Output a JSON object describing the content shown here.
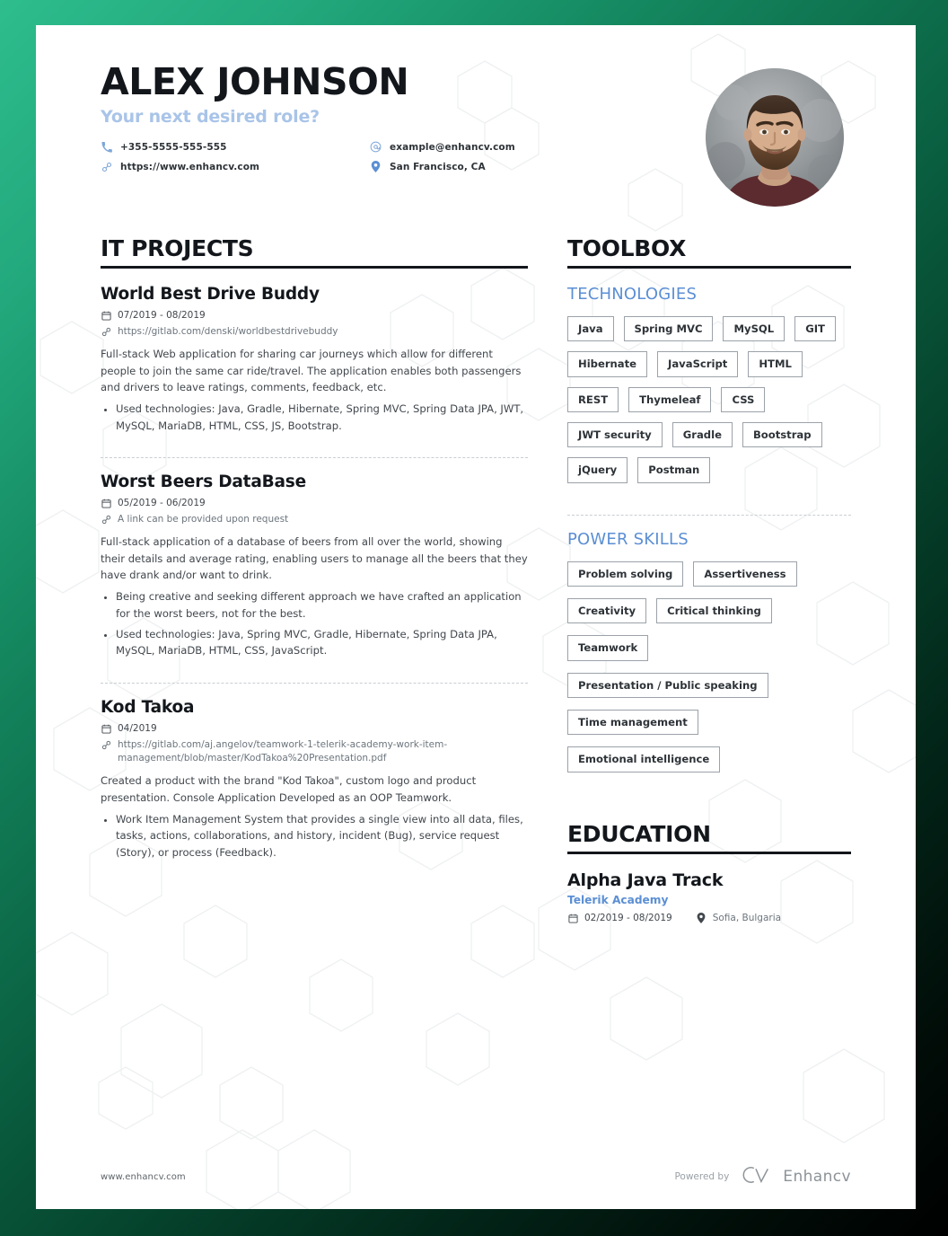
{
  "header": {
    "name": "ALEX JOHNSON",
    "tagline": "Your next desired role?",
    "contacts": [
      {
        "icon": "phone-icon",
        "text": "+355-5555-555-555"
      },
      {
        "icon": "email-icon",
        "text": "example@enhancv.com"
      },
      {
        "icon": "link-icon",
        "text": "https://www.enhancv.com"
      },
      {
        "icon": "location-icon",
        "text": "San Francisco, CA"
      }
    ],
    "avatar_alt": "profile-photo"
  },
  "projects": {
    "section_title": "IT PROJECTS",
    "entries": [
      {
        "title": "World Best Drive Buddy",
        "date": "07/2019 - 08/2019",
        "link": "https://gitlab.com/denski/worldbestdrivebuddy",
        "description": "Full-stack Web application for sharing car journeys which allow for different people to join the same car ride/travel. The application enables both passengers and drivers to leave ratings, comments, feedback, etc.",
        "bullets": [
          "Used technologies: Java, Gradle, Hibernate, Spring MVC, Spring Data JPA, JWT, MySQL, MariaDB, HTML, CSS, JS, Bootstrap."
        ]
      },
      {
        "title": "Worst Beers DataBase",
        "date": "05/2019 - 06/2019",
        "link": "A link can be provided upon request",
        "description": "Full-stack application of a database of beers from all over the world, showing their details and average rating, enabling users to manage all the beers that they have drank and/or want to drink.",
        "bullets": [
          "Being creative and seeking different approach we have crafted an application for the worst beers, not for the best.",
          "Used technologies: Java, Spring MVC, Gradle, Hibernate, Spring Data JPA, MySQL, MariaDB, HTML, CSS, JavaScript."
        ]
      },
      {
        "title": "Kod Takoa",
        "date": "04/2019",
        "link": "https://gitlab.com/aj.angelov/teamwork-1-telerik-academy-work-item-management/blob/master/KodTakoa%20Presentation.pdf",
        "description": "Created a product with the brand \"Kod Takoa\", custom logo and product presentation. Console Application Developed as an OOP Teamwork.",
        "bullets": [
          "Work Item Management System that provides a single view into all data, files, tasks, actions, collaborations, and history, incident (Bug), service request (Story), or process (Feedback)."
        ]
      }
    ]
  },
  "toolbox": {
    "section_title": "TOOLBOX",
    "technologies_title": "TECHNOLOGIES",
    "technologies": [
      "Java",
      "Spring MVC",
      "MySQL",
      "GIT",
      "Hibernate",
      "JavaScript",
      "HTML",
      "REST",
      "Thymeleaf",
      "CSS",
      "JWT security",
      "Gradle",
      "Bootstrap",
      "jQuery",
      "Postman"
    ],
    "power_skills_title": "POWER SKILLS",
    "power_skills": [
      "Problem solving",
      "Assertiveness",
      "Creativity",
      "Critical thinking",
      "Teamwork",
      "Presentation / Public speaking",
      "Time management",
      "Emotional intelligence"
    ]
  },
  "education": {
    "section_title": "EDUCATION",
    "entries": [
      {
        "title": "Alpha Java Track",
        "organization": "Telerik Academy",
        "date": "02/2019 - 08/2019",
        "location": "Sofia, Bulgaria"
      }
    ]
  },
  "footer": {
    "url": "www.enhancv.com",
    "powered_by": "Powered by",
    "brand": "Enhancv"
  },
  "colors": {
    "accent_blue": "#5b8fd4",
    "tagline_blue": "#a9c4e8",
    "ink": "#13171c",
    "body_text": "#41474d",
    "muted": "#6c757d",
    "tag_border": "#9ba2a9",
    "bg_gradient_start": "#2ebd8d",
    "bg_gradient_end": "#000000"
  }
}
